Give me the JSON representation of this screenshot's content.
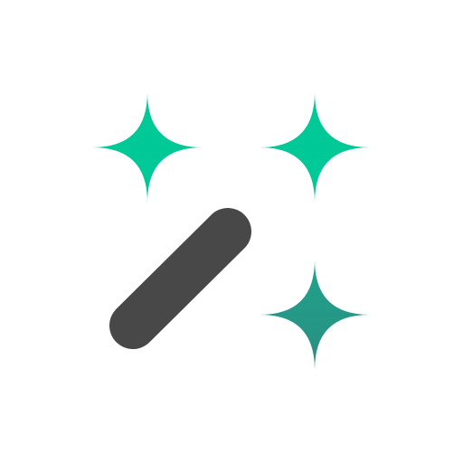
{
  "icon": {
    "name": "magic-wand-icon",
    "colors": {
      "background": "#FFFFFF",
      "sparkle_top_left": "#00C896",
      "sparkle_top_right": "#00C896",
      "sparkle_bottom_right": "#229987",
      "wand": "#484848"
    }
  }
}
